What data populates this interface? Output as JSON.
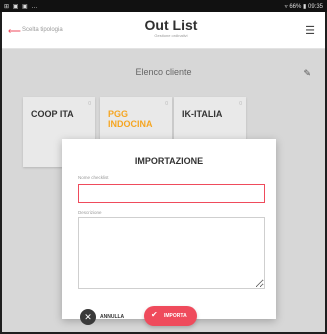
{
  "status_bar": {
    "left": "⊞ ▣ ▣ …",
    "right": "▿ 66% ▮ 09:35"
  },
  "app_bar": {
    "back_icon": "arrow-left-icon",
    "back_label": "Scelta tipologia",
    "logo": "Out List",
    "tagline": "Gestione ordinativi",
    "menu_icon": "hamburger-menu-icon"
  },
  "section": {
    "title": "Elenco cliente",
    "edit_icon": "pencil-icon"
  },
  "cards": [
    {
      "name": "COOP ITA",
      "corner": "0",
      "color": "#333333"
    },
    {
      "name": "PGG INDOCINA",
      "corner": "0",
      "color": "#f5a623"
    },
    {
      "name": "IK-ITALIA",
      "corner": "0",
      "color": "#333333"
    }
  ],
  "dialog": {
    "title": "IMPORTAZIONE",
    "nome_label": "Nome checklist",
    "nome_value": "",
    "descrizione_label": "Descrizione",
    "descrizione_value": "",
    "annulla_label": "ANNULLA",
    "importa_label": "IMPORTA"
  },
  "colors": {
    "accent": "#ef4b5c",
    "overlay": "#d7d7d7"
  }
}
